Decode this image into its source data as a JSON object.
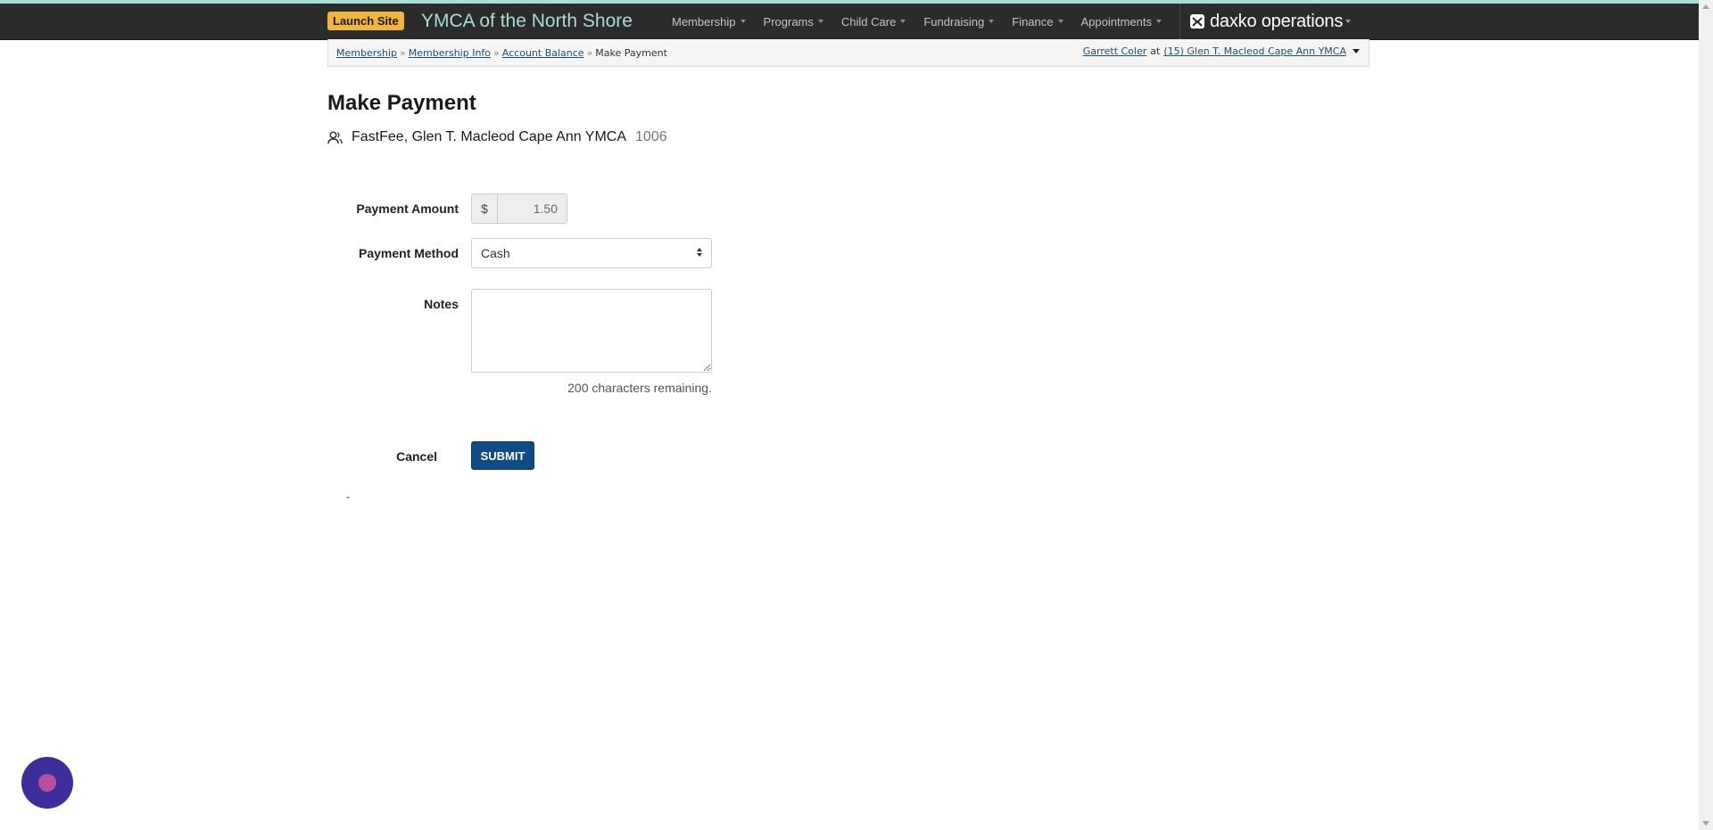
{
  "header": {
    "launch_site_label": "Launch Site",
    "org_title": "YMCA of the North Shore",
    "nav_items": [
      "Membership",
      "Programs",
      "Child Care",
      "Fundraising",
      "Finance",
      "Appointments"
    ],
    "brand_name": "daxko operations",
    "icons": {
      "brand": "daxko-logo-icon",
      "menu_caret": "chevron-down-icon"
    }
  },
  "breadcrumb": {
    "items": [
      "Membership",
      "Membership Info",
      "Account Balance"
    ],
    "current": "Make Payment",
    "separator": "»",
    "user_name": "Garrett Coler",
    "at_text": "at",
    "location": "(15) Glen T. Macleod Cape Ann YMCA"
  },
  "page": {
    "title": "Make Payment",
    "member_name": "FastFee, Glen T. Macleod Cape Ann YMCA",
    "member_id": "1006",
    "member_icon": "person-icon"
  },
  "form": {
    "payment_amount_label": "Payment Amount",
    "currency_symbol": "$",
    "payment_amount_value": "1.50",
    "payment_method_label": "Payment Method",
    "payment_method_value": "Cash",
    "notes_label": "Notes",
    "notes_value": "",
    "chars_remaining": "200 characters remaining.",
    "cancel_label": "Cancel",
    "submit_label": "SUBMIT",
    "stray_text": "-"
  },
  "colors": {
    "navbar_bg": "#2b2b2b",
    "title_accent": "#a9dcd6",
    "launch_button": "#f2b53b",
    "submit_button": "#0f4b84",
    "chat_widget": "#3c2f9c"
  },
  "chat_widget": {
    "icon": "chat-launcher-icon"
  }
}
